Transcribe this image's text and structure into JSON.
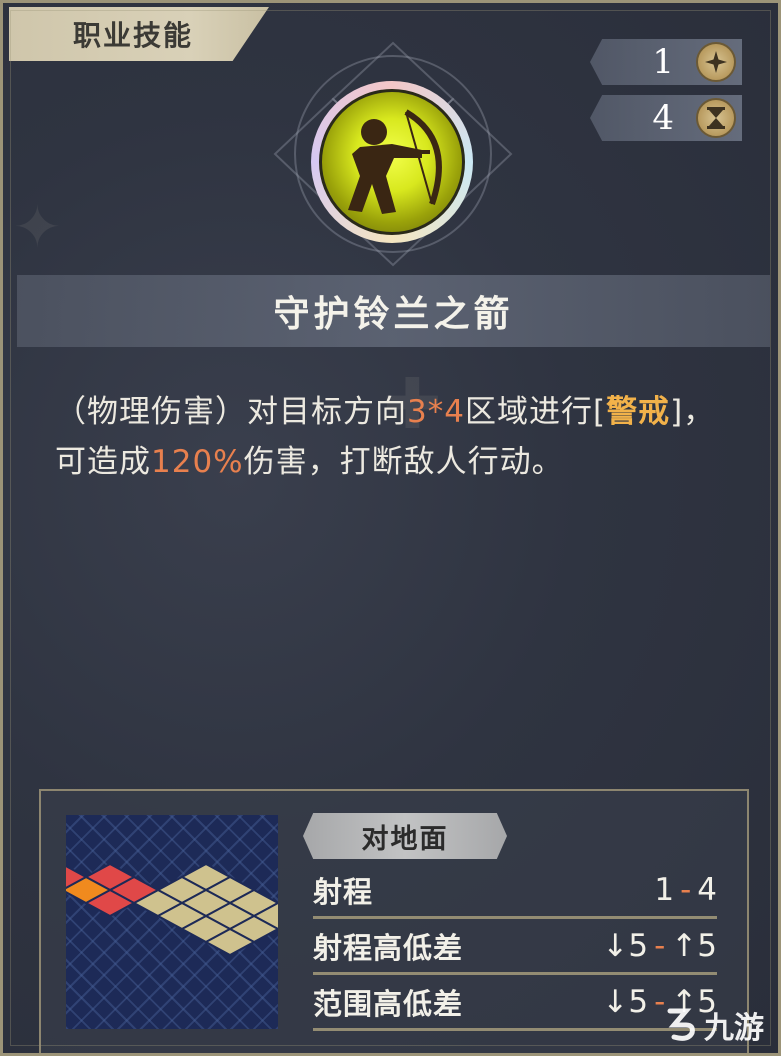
{
  "tab": {
    "label": "职业技能"
  },
  "stats": [
    {
      "value": "1",
      "icon": "sparkle-icon"
    },
    {
      "value": "4",
      "icon": "hourglass-icon"
    }
  ],
  "skill": {
    "icon": "archer-skill-icon",
    "name": "守护铃兰之箭",
    "description": {
      "part1": "（物理伤害）对目标方向",
      "area": "3*4",
      "part2": "区域进行[",
      "keyword": "警戒",
      "part3": "]，可造成",
      "percent": "120%",
      "part4": "伤害，打断敌人行动。"
    }
  },
  "info": {
    "tag": "对地面",
    "rows": [
      {
        "label": "射程",
        "min": "1",
        "max": "4"
      },
      {
        "label": "射程高低差",
        "min": "↓5",
        "max": "↑5"
      },
      {
        "label": "范围高低差",
        "min": "↓5",
        "max": "↑5"
      }
    ]
  },
  "watermark": {
    "text": "九游"
  },
  "colors": {
    "accent_orange": "#e8804e",
    "keyword_gold": "#f2b24a",
    "frame": "#9c9478"
  }
}
